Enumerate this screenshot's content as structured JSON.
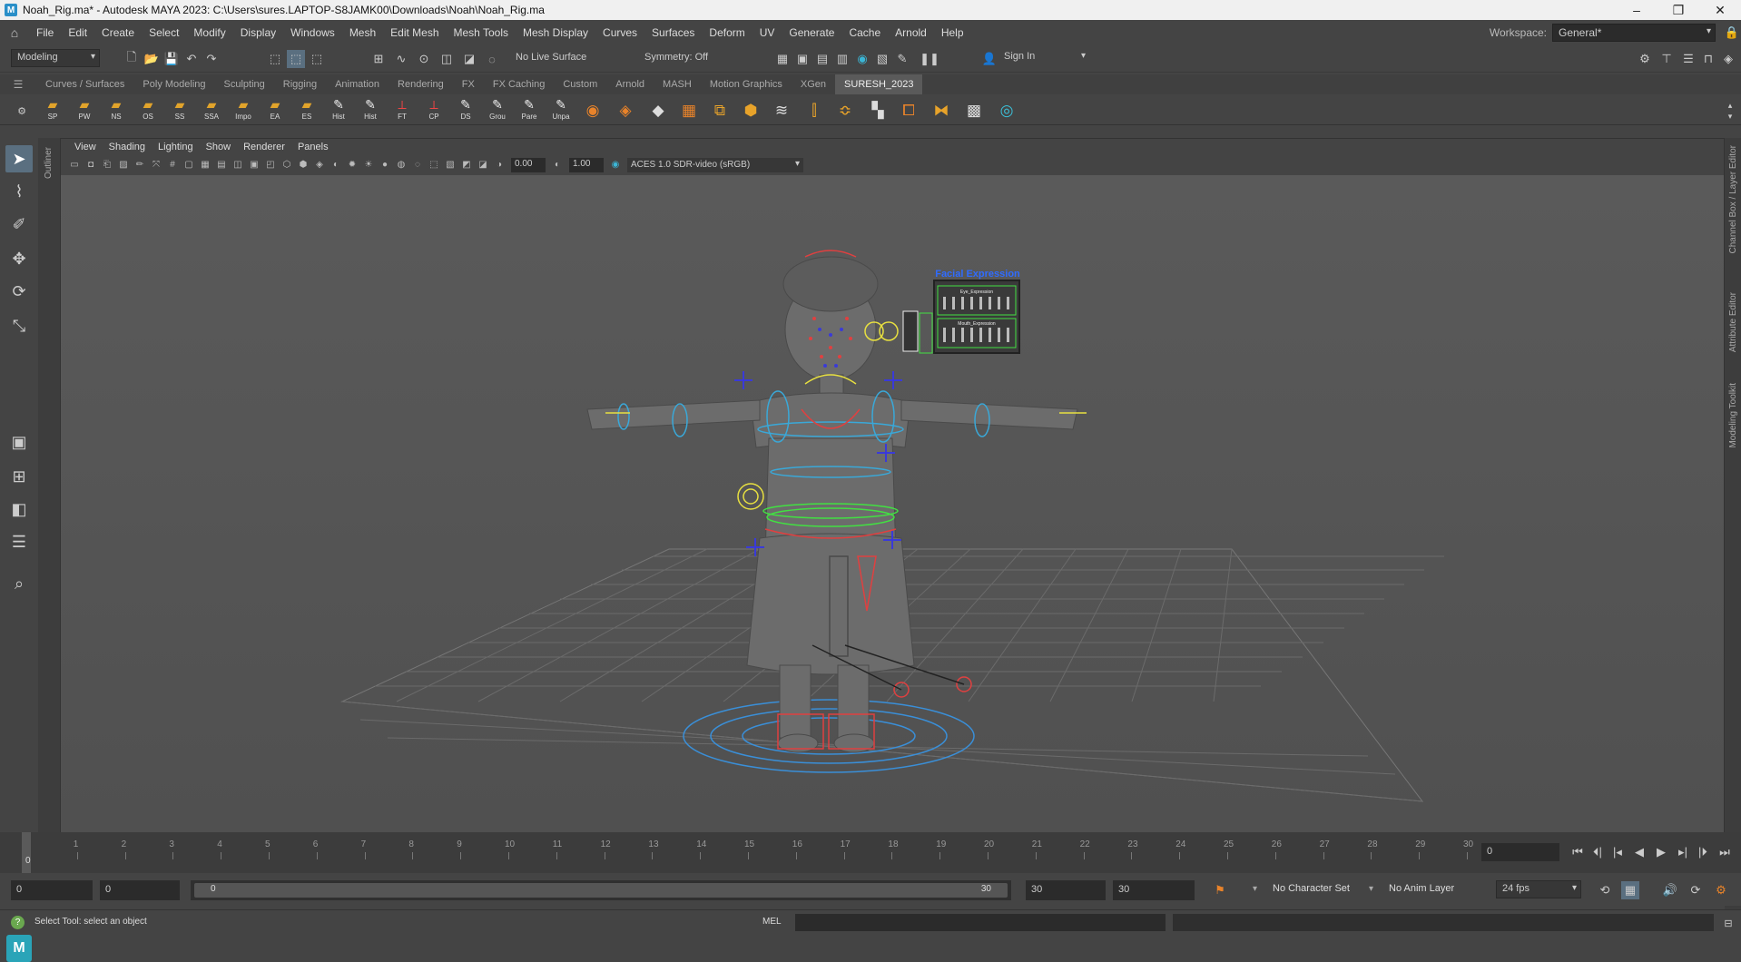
{
  "window": {
    "title": "Noah_Rig.ma* - Autodesk MAYA 2023: C:\\Users\\sures.LAPTOP-S8JAMK00\\Downloads\\Noah\\Noah_Rig.ma",
    "app_icon": "M",
    "minimize": "–",
    "maximize": "❐",
    "close": "✕"
  },
  "menu": [
    "File",
    "Edit",
    "Create",
    "Select",
    "Modify",
    "Display",
    "Windows",
    "Mesh",
    "Edit Mesh",
    "Mesh Tools",
    "Mesh Display",
    "Curves",
    "Surfaces",
    "Deform",
    "UV",
    "Generate",
    "Cache",
    "Arnold",
    "Help"
  ],
  "workspace": {
    "label": "Workspace:",
    "value": "General*"
  },
  "statusline": {
    "mode": "Modeling",
    "live_surface": "No Live Surface",
    "symmetry": "Symmetry: Off",
    "signin": "Sign In"
  },
  "shelf_tabs": [
    "Curves / Surfaces",
    "Poly Modeling",
    "Sculpting",
    "Rigging",
    "Animation",
    "Rendering",
    "FX",
    "FX Caching",
    "Custom",
    "Arnold",
    "MASH",
    "Motion Graphics",
    "XGen",
    "SURESH_2023"
  ],
  "active_shelf_tab": "SURESH_2023",
  "shelf_buttons": [
    {
      "label": "SP",
      "icon": "folder-icon"
    },
    {
      "label": "PW",
      "icon": "folder-icon"
    },
    {
      "label": "NS",
      "icon": "folder-icon"
    },
    {
      "label": "OS",
      "icon": "folder-icon"
    },
    {
      "label": "SS",
      "icon": "folder-icon"
    },
    {
      "label": "SSA",
      "icon": "folder-icon"
    },
    {
      "label": "Impo",
      "icon": "folder-icon"
    },
    {
      "label": "EA",
      "icon": "folder-icon"
    },
    {
      "label": "ES",
      "icon": "folder-icon"
    },
    {
      "label": "Hist",
      "icon": "script-icon"
    },
    {
      "label": "Hist",
      "icon": "script-icon"
    },
    {
      "label": "FT",
      "icon": "axes-icon"
    },
    {
      "label": "CP",
      "icon": "axes-icon"
    },
    {
      "label": "DS",
      "icon": "script-icon"
    },
    {
      "label": "Grou",
      "icon": "script-icon"
    },
    {
      "label": "Pare",
      "icon": "script-icon"
    },
    {
      "label": "Unpa",
      "icon": "script-icon"
    }
  ],
  "viewport": {
    "menus": [
      "View",
      "Shading",
      "Lighting",
      "Show",
      "Renderer",
      "Panels"
    ],
    "exposure": "0.00",
    "gamma": "1.00",
    "colorspace": "ACES 1.0 SDR-video (sRGB)",
    "facial_panel": {
      "title": "Facial Expression",
      "eye": "Eye_Expression",
      "mouth": "Mouth_Expression"
    }
  },
  "side_labels": {
    "outliner": "Outliner",
    "channel_box": "Channel Box / Layer Editor",
    "attribute_editor": "Attribute Editor",
    "modeling_toolkit": "Modeling Toolkit"
  },
  "timeline": {
    "ticks": [
      "0",
      "1",
      "2",
      "3",
      "4",
      "5",
      "6",
      "7",
      "8",
      "9",
      "10",
      "11",
      "12",
      "13",
      "14",
      "15",
      "16",
      "17",
      "18",
      "19",
      "20",
      "21",
      "22",
      "23",
      "24",
      "25",
      "26",
      "27",
      "28",
      "29",
      "30"
    ],
    "current_frame": "0",
    "current_frame_field": "0"
  },
  "range": {
    "start": "0",
    "playback_start": "0",
    "range_start_label": "0",
    "range_end_label": "30",
    "playback_end": "30",
    "end": "30",
    "character_set": "No Character Set",
    "anim_layer": "No Anim Layer",
    "fps": "24 fps"
  },
  "status": {
    "help_text": "Select Tool: select an object",
    "mel_label": "MEL"
  },
  "colors": {
    "titlebar": "#f0f0f0",
    "ui_bg": "#444444",
    "viewport_bg": "#575757",
    "active_tab": "#5a5a5a",
    "maya_logo": "#2aa4b8"
  }
}
